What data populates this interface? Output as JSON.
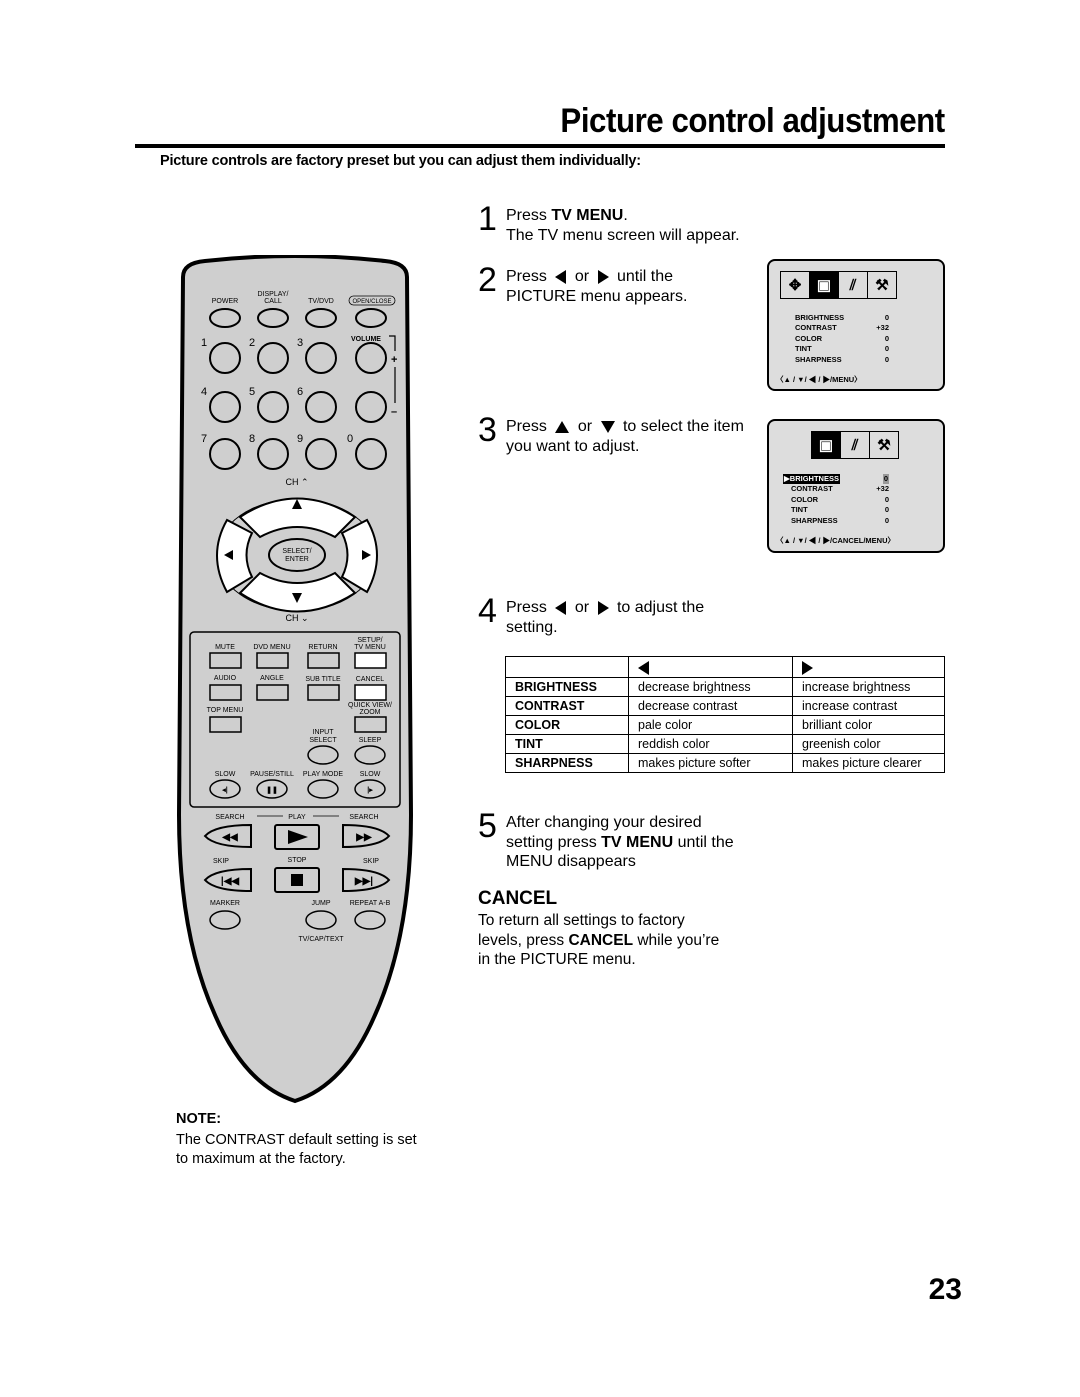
{
  "header": {
    "title": "Picture control adjustment",
    "subtitle": "Picture controls are factory preset but you can adjust them individually:"
  },
  "steps": [
    {
      "num": "1",
      "pre": "Press ",
      "bold": "TV MENU",
      "post": ".",
      "line2": "The TV menu screen will appear."
    },
    {
      "num": "2",
      "pre": "Press",
      "mid": "or",
      "post": "until the",
      "line2": "PICTURE menu appears."
    },
    {
      "num": "3",
      "pre": "Press",
      "mid": "or",
      "post": "to select the item",
      "line2": "you want to adjust."
    },
    {
      "num": "4",
      "pre": "Press",
      "mid": "or",
      "post": "to adjust the",
      "line2": "setting."
    },
    {
      "num": "5",
      "line1": "After changing your desired",
      "pre2": "setting press ",
      "bold": "TV MENU",
      "post2": " until the",
      "line3": "MENU disappears"
    }
  ],
  "screen1": {
    "icons": [
      "move-arrows-icon",
      "picture-icon",
      "antenna-icon",
      "tools-icon"
    ],
    "rows": [
      {
        "label": "BRIGHTNESS",
        "value": "0"
      },
      {
        "label": "CONTRAST",
        "value": "+32"
      },
      {
        "label": "COLOR",
        "value": "0"
      },
      {
        "label": "TINT",
        "value": "0"
      },
      {
        "label": "SHARPNESS",
        "value": "0"
      }
    ],
    "hint": "〈▲ / ▼/ ◀ / ▶/MENU〉"
  },
  "screen2": {
    "icons": [
      "picture-icon",
      "antenna-icon",
      "tools-icon"
    ],
    "rows": [
      {
        "label": "BRIGHTNESS",
        "value": "0",
        "selected": true
      },
      {
        "label": "CONTRAST",
        "value": "+32"
      },
      {
        "label": "COLOR",
        "value": "0"
      },
      {
        "label": "TINT",
        "value": "0"
      },
      {
        "label": "SHARPNESS",
        "value": "0"
      }
    ],
    "hint": "〈▲ / ▼/ ◀ / ▶/CANCEL/MENU〉"
  },
  "table": {
    "columns": [
      "",
      "◀",
      "▶"
    ],
    "rows": [
      {
        "setting": "BRIGHTNESS",
        "left": "decrease brightness",
        "right": "increase brightness"
      },
      {
        "setting": "CONTRAST",
        "left": "decrease contrast",
        "right": "increase contrast"
      },
      {
        "setting": "COLOR",
        "left": "pale color",
        "right": "brilliant color"
      },
      {
        "setting": "TINT",
        "left": "reddish color",
        "right": "greenish color"
      },
      {
        "setting": "SHARPNESS",
        "left": "makes picture softer",
        "right": "makes picture clearer"
      }
    ]
  },
  "cancel": {
    "heading": "CANCEL",
    "line1": "To return all settings to factory",
    "pre2": "levels, press ",
    "bold": "CANCEL",
    "post2": " while you’re",
    "line3": "in the PICTURE menu."
  },
  "note": {
    "heading": "NOTE:",
    "line1": "The CONTRAST default setting is set",
    "line2": "to maximum at the factory."
  },
  "page_number": "23",
  "remote": {
    "top_labels": [
      "POWER",
      "DISPLAY/",
      "CALL",
      "TV/DVD",
      "OPEN/CLOSE"
    ],
    "digits": [
      "1",
      "2",
      "3",
      "4",
      "5",
      "6",
      "7",
      "8",
      "9",
      "0"
    ],
    "volume": "VOLUME",
    "vol_plus": "+",
    "vol_minus": "–",
    "ch_up": "CH ⌃",
    "ch_down": "CH ⌄",
    "select1": "SELECT/",
    "select2": "ENTER",
    "row1": [
      "MUTE",
      "DVD MENU",
      "RETURN",
      "SETUP/",
      "TV MENU"
    ],
    "row2": [
      "AUDIO",
      "ANGLE",
      "SUB TITLE",
      "CANCEL"
    ],
    "row3": [
      "TOP MENU",
      "QUICK VIEW/",
      "ZOOM"
    ],
    "row4": [
      "INPUT",
      "SELECT",
      "SLEEP"
    ],
    "row5": [
      "SLOW",
      "PAUSE/STILL",
      "PLAY MODE",
      "SLOW"
    ],
    "search": [
      "SEARCH",
      "PLAY",
      "SEARCH"
    ],
    "skip": [
      "SKIP",
      "STOP",
      "SKIP"
    ],
    "bottom": [
      "MARKER",
      "JUMP",
      "REPEAT A-B",
      "TV/CAP/TEXT"
    ]
  }
}
